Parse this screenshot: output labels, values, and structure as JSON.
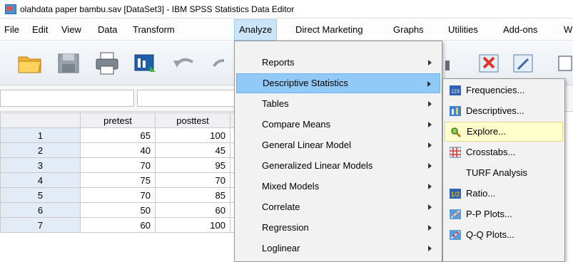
{
  "window": {
    "title": "olahdata paper bambu.sav [DataSet3] - IBM SPSS Statistics Data Editor"
  },
  "menubar": {
    "file": "File",
    "edit": "Edit",
    "view": "View",
    "data": "Data",
    "transform": "Transform",
    "analyze": "Analyze",
    "direct_marketing": "Direct Marketing",
    "graphs": "Graphs",
    "utilities": "Utilities",
    "addons": "Add-ons",
    "window": "W"
  },
  "analyze_menu": {
    "reports": "Reports",
    "descriptive_statistics": "Descriptive Statistics",
    "tables": "Tables",
    "compare_means": "Compare Means",
    "general_linear_model": "General Linear Model",
    "generalized_linear_models": "Generalized Linear Models",
    "mixed_models": "Mixed Models",
    "correlate": "Correlate",
    "regression": "Regression",
    "loglinear": "Loglinear"
  },
  "descriptive_submenu": {
    "frequencies": "Frequencies...",
    "descriptives": "Descriptives...",
    "explore": "Explore...",
    "crosstabs": "Crosstabs...",
    "turf": "TURF Analysis",
    "ratio": "Ratio...",
    "pp_plots": "P-P Plots...",
    "qq_plots": "Q-Q Plots..."
  },
  "grid": {
    "columns": [
      "pretest",
      "posttest"
    ],
    "rows": [
      {
        "n": "1",
        "pretest": "65",
        "posttest": "100"
      },
      {
        "n": "2",
        "pretest": "40",
        "posttest": "45"
      },
      {
        "n": "3",
        "pretest": "70",
        "posttest": "95"
      },
      {
        "n": "4",
        "pretest": "75",
        "posttest": "70"
      },
      {
        "n": "5",
        "pretest": "70",
        "posttest": "85"
      },
      {
        "n": "6",
        "pretest": "50",
        "posttest": "60"
      },
      {
        "n": "7",
        "pretest": "60",
        "posttest": "100"
      }
    ]
  },
  "colors": {
    "menu_highlight": "#91c9f7",
    "submenu_highlight": "#ffffcc",
    "row_header": "#e3ecf6"
  }
}
